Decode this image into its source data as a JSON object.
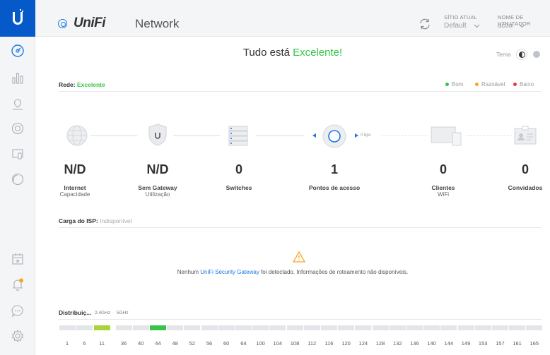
{
  "header": {
    "brand_prefix": "UniFi",
    "brand_suffix": "Network",
    "site_label": "SÍTIO ATUAL",
    "site_value": "Default",
    "user_label": "NOME DE UTILIZADOR",
    "user_value": "actia"
  },
  "headline": {
    "prefix": "Tudo está ",
    "status": "Excelente!"
  },
  "theme": {
    "label": "Tema"
  },
  "network": {
    "label": "Rede:",
    "status": "Excelente"
  },
  "legend": [
    {
      "label": "Bom",
      "color": "#37c449"
    },
    {
      "label": "Razoável",
      "color": "#f5a623"
    },
    {
      "label": "Baixo",
      "color": "#e33b3b"
    }
  ],
  "devices": [
    {
      "count": "N/D",
      "label": "Internet",
      "sub": "Capacidade"
    },
    {
      "count": "N/D",
      "label": "Sem Gateway",
      "sub": "Utilização"
    },
    {
      "count": "0",
      "label": "Switches",
      "sub": ""
    },
    {
      "count": "1",
      "label": "Pontos de acesso",
      "sub": ""
    },
    {
      "count": "0",
      "label": "Clientes",
      "sub": "WiFi"
    },
    {
      "count": "0",
      "label": "Convidados",
      "sub": ""
    }
  ],
  "ap_rate": "0 bps",
  "isp": {
    "label": "Carga do ISP:",
    "value": "Indisponível"
  },
  "warning": {
    "prefix": "Nenhum ",
    "link": "UniFi Security Gateway",
    "suffix": " foi detectado. Informações de roteamento não disponíveis."
  },
  "distribution": {
    "title": "Distribuiç...",
    "tab_24": "2.4GHz",
    "tab_5": "5GHz",
    "channels_24": [
      "1",
      "6",
      "11"
    ],
    "channels_5": [
      "36",
      "40",
      "44",
      "48",
      "52",
      "56",
      "60",
      "64",
      "100",
      "104",
      "108",
      "112",
      "116",
      "120",
      "124",
      "128",
      "132",
      "136",
      "140",
      "144",
      "149",
      "153",
      "157",
      "161",
      "165"
    ],
    "active_24": "11",
    "active_5": "44",
    "active_24_color": "#a8d43a",
    "active_5_color": "#37c449"
  }
}
